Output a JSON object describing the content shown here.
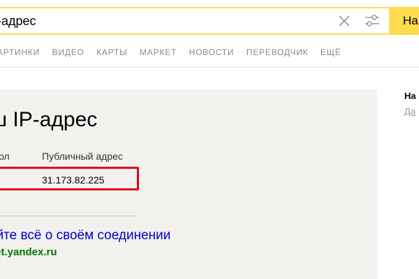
{
  "search": {
    "value": "-адрес",
    "button_label": "На",
    "clear_icon": "close-icon",
    "filter_icon": "settings-sliders-icon"
  },
  "nav": {
    "items": [
      "КАРТИНКИ",
      "ВИДЕО",
      "КАРТЫ",
      "МАРКЕТ",
      "НОВОСТИ",
      "ПЕРЕВОДЧИК",
      "ЕЩЁ"
    ]
  },
  "card": {
    "title": "ш IP-адрес",
    "columns": {
      "protocol": "окол",
      "public_address": "Публичный адрес"
    },
    "ip_value": "31.173.82.225",
    "more_link": "айте всё о своём соединении",
    "site_link": "net.yandex.ru",
    "highlight_color": "#e0001b",
    "background_color": "#f2f1ed"
  },
  "right": {
    "title": "На",
    "link": "Да"
  },
  "colors": {
    "accent": "#ffdb4d",
    "link": "#0000cc",
    "site": "#007700"
  }
}
